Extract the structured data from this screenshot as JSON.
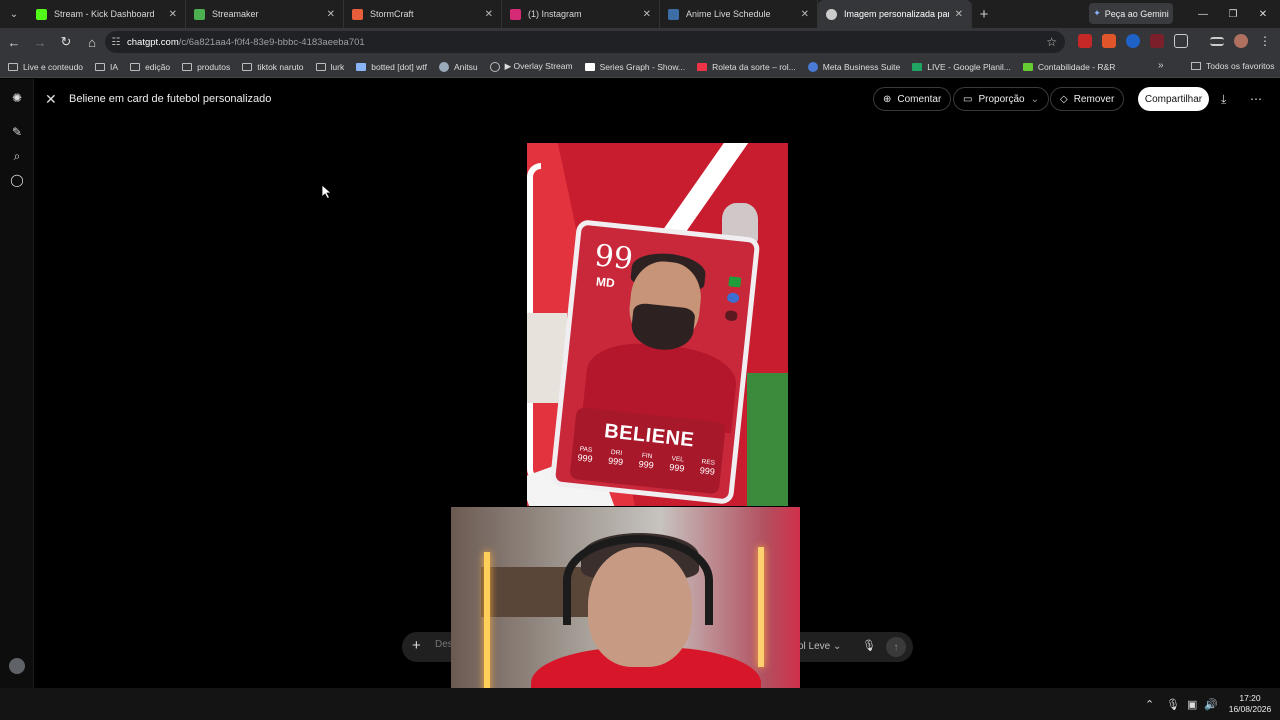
{
  "browser": {
    "tabs": [
      {
        "title": "Stream - Kick Dashboard",
        "favicon_color": "#53fc18"
      },
      {
        "title": "Streamaker",
        "favicon_color": "#4caf50"
      },
      {
        "title": "StormCraft",
        "favicon_color": "#e85d3a"
      },
      {
        "title": "(1) Instagram",
        "favicon_color": "#d62976"
      },
      {
        "title": "Anime Live Schedule",
        "favicon_color": "#3a6ea5"
      },
      {
        "title": "Imagem personalizada para usu",
        "favicon_color": "#cccccc"
      }
    ],
    "gemini_button": "Peça ao Gemini",
    "url": {
      "host": "chatgpt.com",
      "path": "/c/6a821aa4-f0f4-83e9-bbbc-4183aeeba701"
    },
    "bookmarks": [
      {
        "label": "Live e conteudo",
        "icon": "folder-icon"
      },
      {
        "label": "IA",
        "icon": "folder-icon"
      },
      {
        "label": "edição",
        "icon": "folder-icon"
      },
      {
        "label": "produtos",
        "icon": "folder-icon"
      },
      {
        "label": "tiktok naruto",
        "icon": "folder-icon"
      },
      {
        "label": "lurk",
        "icon": "folder-icon"
      },
      {
        "label": "botted [dot] wtf",
        "icon": "site-icon"
      },
      {
        "label": "Anitsu",
        "icon": "site-icon"
      },
      {
        "label": "▶ Overlay Stream",
        "icon": "globe-icon"
      },
      {
        "label": "Series Graph - Show...",
        "icon": "site-icon"
      },
      {
        "label": "Roleta da sorte – rol...",
        "icon": "site-icon"
      },
      {
        "label": "Meta Business Suite",
        "icon": "meta-icon"
      },
      {
        "label": "LIVE - Google Planil...",
        "icon": "sheets-icon"
      },
      {
        "label": "Contabilidade - R&R",
        "icon": "site-icon"
      }
    ],
    "all_bookmarks": "Todos os favoritos"
  },
  "app": {
    "image_title": "Beliene em card de futebol personalizado",
    "actions": {
      "comment": "Comentar",
      "proportion": "Proporção",
      "remove": "Remover",
      "share": "Compartilhar"
    },
    "composer": {
      "placeholder": "Descreva ou edite sua imagem",
      "model_label": "ol Leve"
    }
  },
  "card": {
    "rating": "99",
    "position": "MD",
    "name": "BELIENE",
    "stats": [
      {
        "label": "PAS",
        "value": "999"
      },
      {
        "label": "DRI",
        "value": "999"
      },
      {
        "label": "FIN",
        "value": "999"
      },
      {
        "label": "VEL",
        "value": "999"
      },
      {
        "label": "RES",
        "value": "999"
      }
    ]
  },
  "taskbar": {
    "time": "17:20",
    "date": "16/08/2026"
  },
  "colors": {
    "accent_red": "#c8283a",
    "chrome_bg": "#35363a"
  }
}
